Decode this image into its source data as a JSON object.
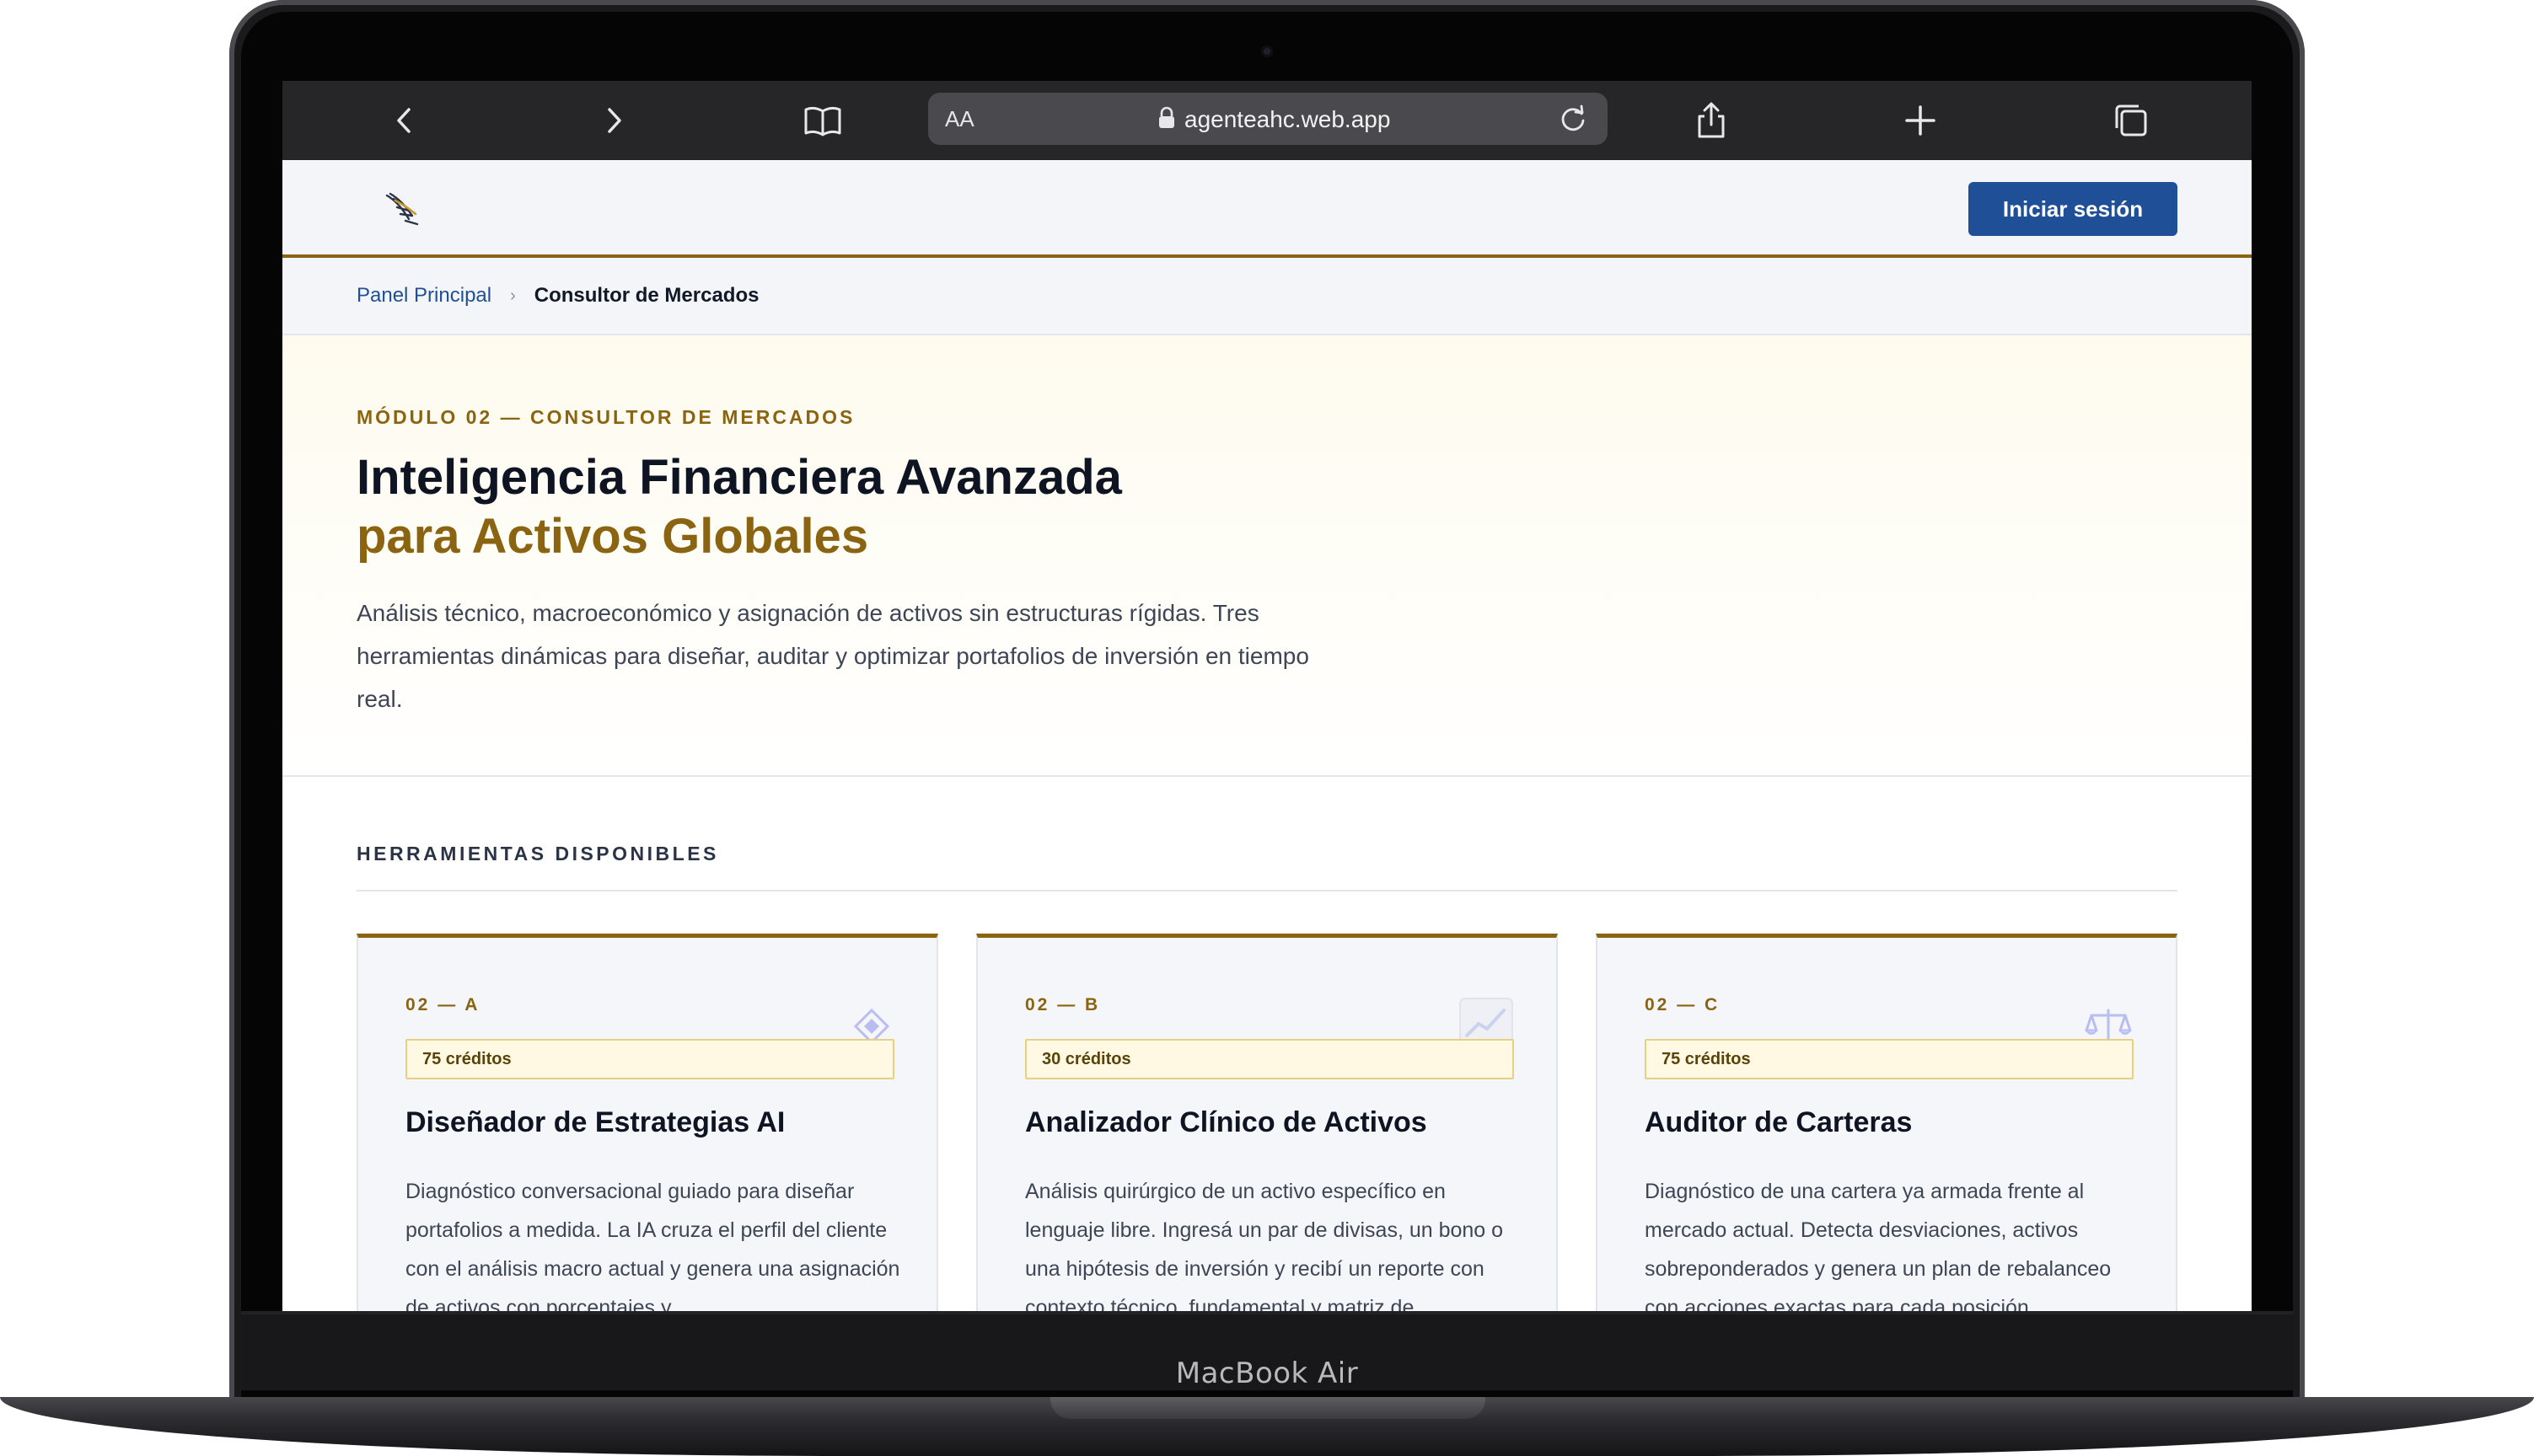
{
  "device": {
    "label": "MacBook Air"
  },
  "browser": {
    "text_size_label": "AA",
    "url": "agenteahc.web.app",
    "icons": [
      "chevron-left-icon",
      "chevron-right-icon",
      "book-icon",
      "lock-icon",
      "reload-icon",
      "share-icon",
      "plus-icon",
      "tabs-icon"
    ]
  },
  "header": {
    "login_label": "Iniciar sesión",
    "accent_color": "#8a6410",
    "button_color": "#1f4f96"
  },
  "breadcrumb": {
    "parent": "Panel Principal",
    "separator": "›",
    "current": "Consultor de Mercados"
  },
  "hero": {
    "kicker": "MÓDULO 02 — CONSULTOR DE MERCADOS",
    "title_line1": "Inteligencia Financiera Avanzada",
    "title_line2": "para Activos Globales",
    "description": "Análisis técnico, macroeconómico y asignación de activos sin estructuras rígidas. Tres herramientas dinámicas para diseñar, auditar y optimizar portafolios de inversión en tiempo real."
  },
  "tools": {
    "section_label": "HERRAMIENTAS DISPONIBLES",
    "cards": [
      {
        "code": "02 — A",
        "credits": "75 créditos",
        "title": "Diseñador de Estrategias AI",
        "icon": "diamond-icon",
        "description": "Diagnóstico conversacional guiado para diseñar portafolios a medida. La IA cruza el perfil del cliente con el análisis macro actual y genera una asignación de activos con porcentajes y"
      },
      {
        "code": "02 — B",
        "credits": "30 créditos",
        "title": "Analizador Clínico de Activos",
        "icon": "chart-icon",
        "description": "Análisis quirúrgico de un activo específico en lenguaje libre. Ingresá un par de divisas, un bono o una hipótesis de inversión y recibí un reporte con contexto técnico, fundamental y matriz de"
      },
      {
        "code": "02 — C",
        "credits": "75 créditos",
        "title": "Auditor de Carteras",
        "icon": "scales-icon",
        "description": "Diagnóstico de una cartera ya armada frente al mercado actual. Detecta desviaciones, activos sobreponderados y genera un plan de rebalanceo con acciones exactas para cada posición."
      }
    ]
  }
}
